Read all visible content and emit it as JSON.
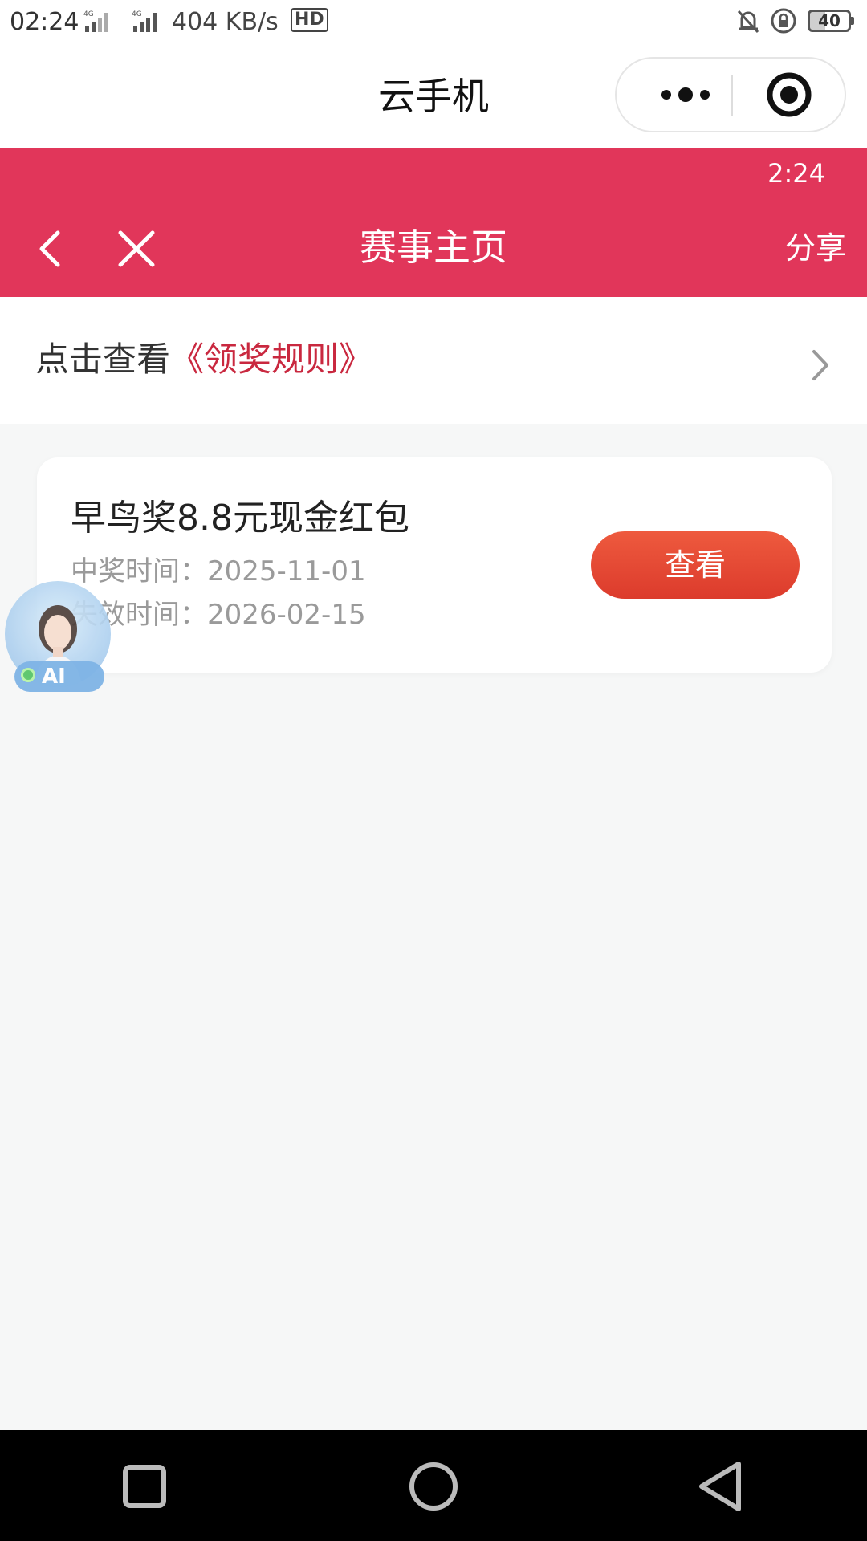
{
  "status_bar": {
    "time": "02:24",
    "net_speed": "404 KB/s",
    "hd_badge": "HD",
    "battery": "40",
    "icons": [
      "signal-4g-icon",
      "signal-4g-icon",
      "hd-icon",
      "mute-bell-icon",
      "rotation-lock-icon",
      "battery-icon"
    ]
  },
  "mini_program": {
    "title": "云手机",
    "capsule_icons": [
      "more-dots-icon",
      "close-target-icon"
    ]
  },
  "event_header": {
    "time": "2:24",
    "title": "赛事主页",
    "share_label": "分享",
    "icons": [
      "back-arrow-icon",
      "close-x-icon"
    ],
    "color": "#e1365a"
  },
  "rules": {
    "prefix": "点击查看",
    "link": "《领奖规则》",
    "link_color": "#c9283f"
  },
  "prize_card": {
    "title": "早鸟奖8.8元现金红包",
    "win_time": "中奖时间：2025-11-01",
    "expire_time": "失效时间：2026-02-15",
    "button_label": "查看",
    "button_color": "#e4462f"
  },
  "ai_float": {
    "label": "AI"
  },
  "nav_bar": {
    "icons": [
      "recents-square-icon",
      "home-circle-icon",
      "back-triangle-icon"
    ]
  }
}
